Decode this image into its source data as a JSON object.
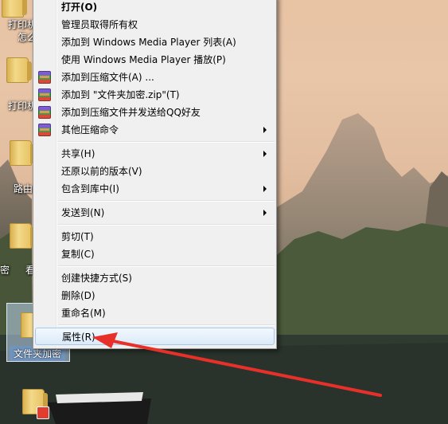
{
  "desktop": {
    "icon_labels": [
      "打印机",
      "怎么",
      "打印机",
      "路由",
      "看",
      "密",
      "文件夹加密"
    ]
  },
  "context_menu": {
    "items": [
      {
        "label": "打开(O)",
        "bold": true
      },
      {
        "label": "管理员取得所有权"
      },
      {
        "label": "添加到 Windows Media Player 列表(A)"
      },
      {
        "label": "使用 Windows Media Player 播放(P)"
      },
      {
        "label": "添加到压缩文件(A) ...",
        "icon": "winrar-icon"
      },
      {
        "label": "添加到 \"文件夹加密.zip\"(T)",
        "icon": "winrar-icon"
      },
      {
        "label": "添加到压缩文件并发送给QQ好友",
        "icon": "winrar-icon"
      },
      {
        "label": "其他压缩命令",
        "icon": "winrar-icon",
        "submenu": true
      },
      {
        "label": "共享(H)",
        "submenu": true
      },
      {
        "label": "还原以前的版本(V)"
      },
      {
        "label": "包含到库中(I)",
        "submenu": true
      },
      {
        "label": "发送到(N)",
        "submenu": true
      },
      {
        "label": "剪切(T)"
      },
      {
        "label": "复制(C)"
      },
      {
        "label": "创建快捷方式(S)"
      },
      {
        "label": "删除(D)"
      },
      {
        "label": "重命名(M)"
      },
      {
        "label": "属性(R)",
        "highlighted": true
      }
    ]
  },
  "colors": {
    "annotation_arrow": "#e8302a",
    "menu_background": "#f0f0f0",
    "highlight_border": "#a8c8ea"
  }
}
